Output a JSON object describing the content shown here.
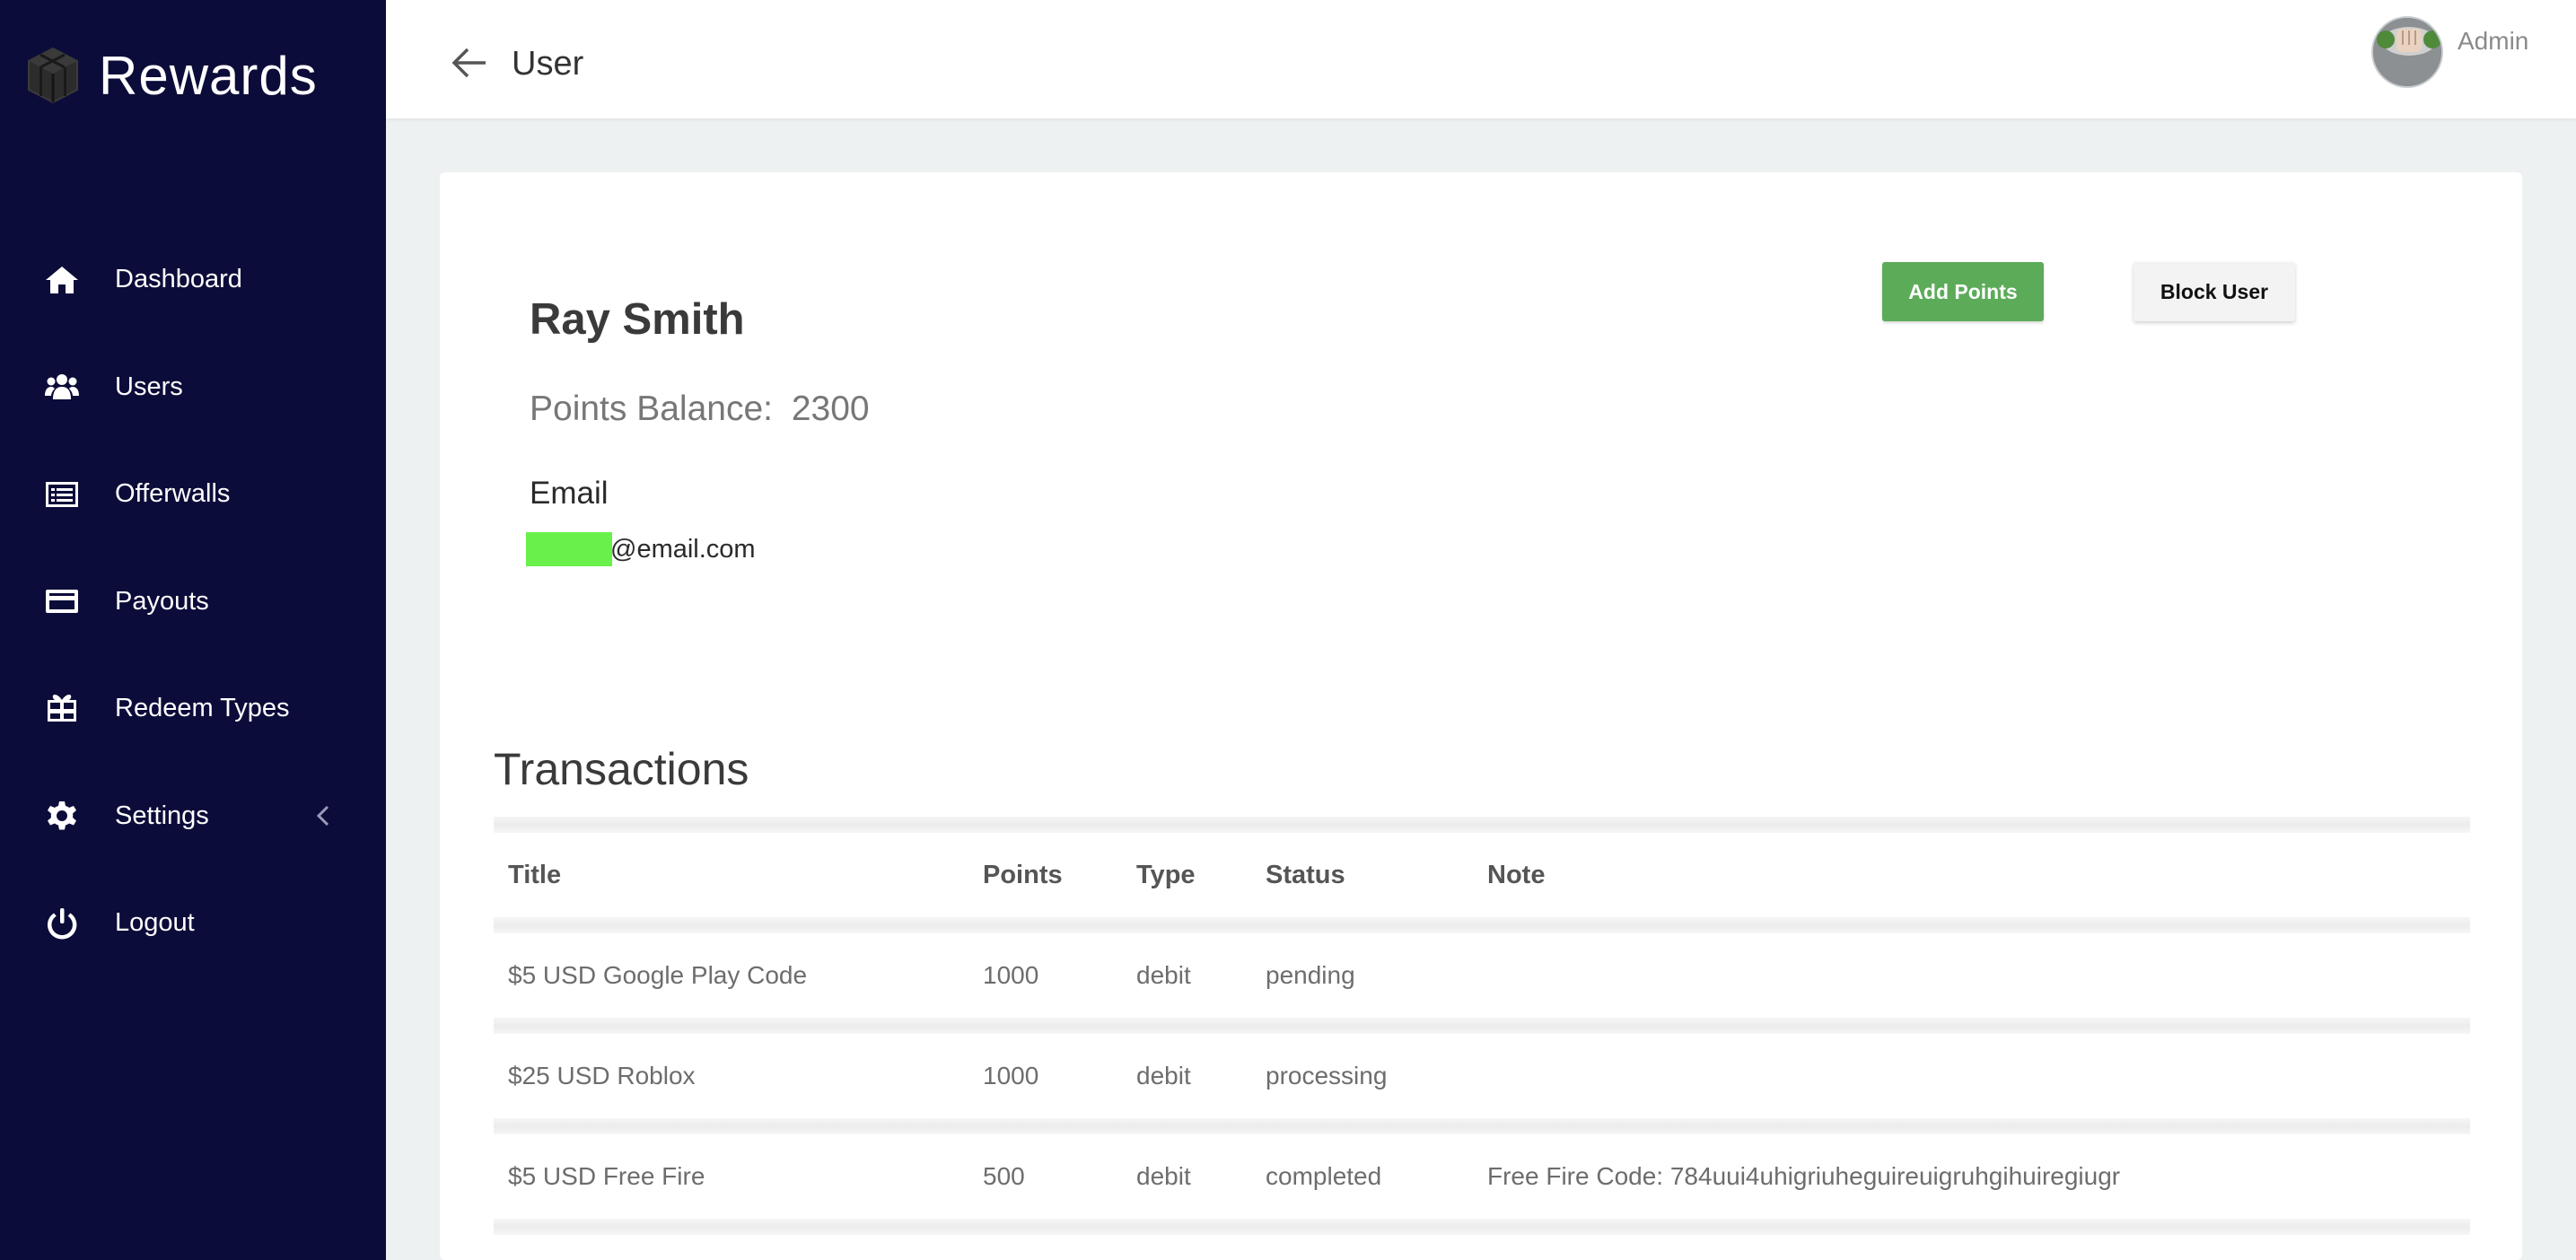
{
  "brand": {
    "title": "Rewards",
    "icon": "cube-icon"
  },
  "sidebar": {
    "items": [
      {
        "label": "Dashboard",
        "icon": "home-icon"
      },
      {
        "label": "Users",
        "icon": "users-icon"
      },
      {
        "label": "Offerwalls",
        "icon": "list-icon"
      },
      {
        "label": "Payouts",
        "icon": "credit-card-icon"
      },
      {
        "label": "Redeem Types",
        "icon": "gift-card-icon"
      },
      {
        "label": "Settings",
        "icon": "gear-icon"
      },
      {
        "label": "Logout",
        "icon": "power-icon"
      }
    ]
  },
  "header": {
    "title": "User",
    "user": "Admin"
  },
  "user": {
    "name": "Ray Smith",
    "points_label": "Points Balance:",
    "points_value": "2300",
    "email_label": "Email",
    "email_visible": "@email.com"
  },
  "actions": {
    "add_points": "Add Points",
    "block_user": "Block User"
  },
  "transactions": {
    "heading": "Transactions",
    "columns": [
      "Title",
      "Points",
      "Type",
      "Status",
      "Note"
    ],
    "rows": [
      {
        "title": "$5 USD Google Play Code",
        "points": "1000",
        "type": "debit",
        "status": "pending",
        "note": ""
      },
      {
        "title": "$25 USD Roblox",
        "points": "1000",
        "type": "debit",
        "status": "processing",
        "note": ""
      },
      {
        "title": "$5 USD Free Fire",
        "points": "500",
        "type": "debit",
        "status": "completed",
        "note": "Free Fire Code: 784uui4uhigriuheguireuigruhgihuiregiugr"
      }
    ]
  },
  "colors": {
    "sidebar_bg": "#0c0c3a",
    "add_button": "#5cab59",
    "redaction": "#6af04a"
  }
}
